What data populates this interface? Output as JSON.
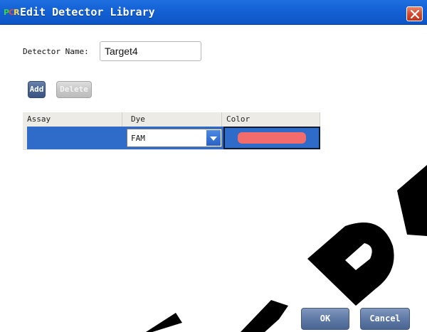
{
  "window": {
    "title": "Edit Detector Library",
    "icon_letters": [
      "P",
      "C",
      "R"
    ]
  },
  "form": {
    "name_label": "Detector Name:",
    "name_value": "Target4"
  },
  "toolbar": {
    "add_label": "Add",
    "delete_label": "Delete"
  },
  "grid": {
    "columns": [
      "Assay",
      "Dye",
      "Color"
    ],
    "rows": [
      {
        "assay": "",
        "dye": "FAM",
        "color": "#f26c6c"
      }
    ]
  },
  "footer": {
    "ok_label": "OK",
    "cancel_label": "Cancel"
  },
  "colors": {
    "titlebar": "#1462d6",
    "selection": "#2f6bc8",
    "close_button": "#d2452a",
    "primary_button": "#5f7aa6"
  }
}
